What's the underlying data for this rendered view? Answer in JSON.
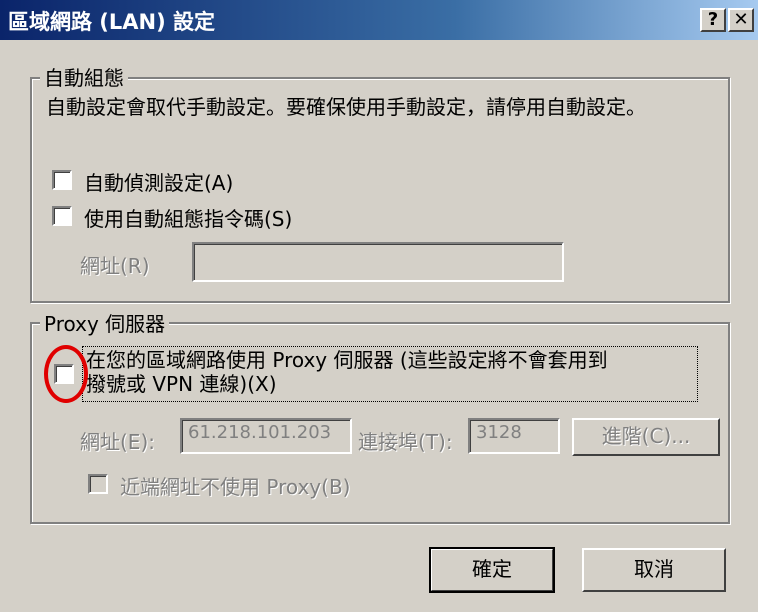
{
  "window": {
    "title": "區域網路 (LAN) 設定",
    "help_button": "?",
    "close_button": "✕"
  },
  "auto_config": {
    "legend": "自動組態",
    "description": "自動設定會取代手動設定。要確保使用手動設定，請停用自動設定。",
    "auto_detect_label": "自動偵測設定(A)",
    "auto_script_label": "使用自動組態指令碼(S)",
    "address_label": "網址(R)",
    "address_value": ""
  },
  "proxy": {
    "legend": "Proxy 伺服器",
    "use_proxy_label_line1": "在您的區域網路使用 Proxy 伺服器 (這些設定將不會套用到",
    "use_proxy_label_line2": "撥號或 VPN 連線)(X)",
    "address_label": "網址(E):",
    "address_value": "61.218.101.203",
    "port_label": "連接埠(T):",
    "port_value": "3128",
    "advanced_button": "進階(C)...",
    "bypass_local_label": "近端網址不使用 Proxy(B)"
  },
  "buttons": {
    "ok": "確定",
    "cancel": "取消"
  },
  "colors": {
    "title_gradient_start": "#0a246a",
    "highlight_circle": "#e00000",
    "dialog_background": "#d4d0c8"
  }
}
